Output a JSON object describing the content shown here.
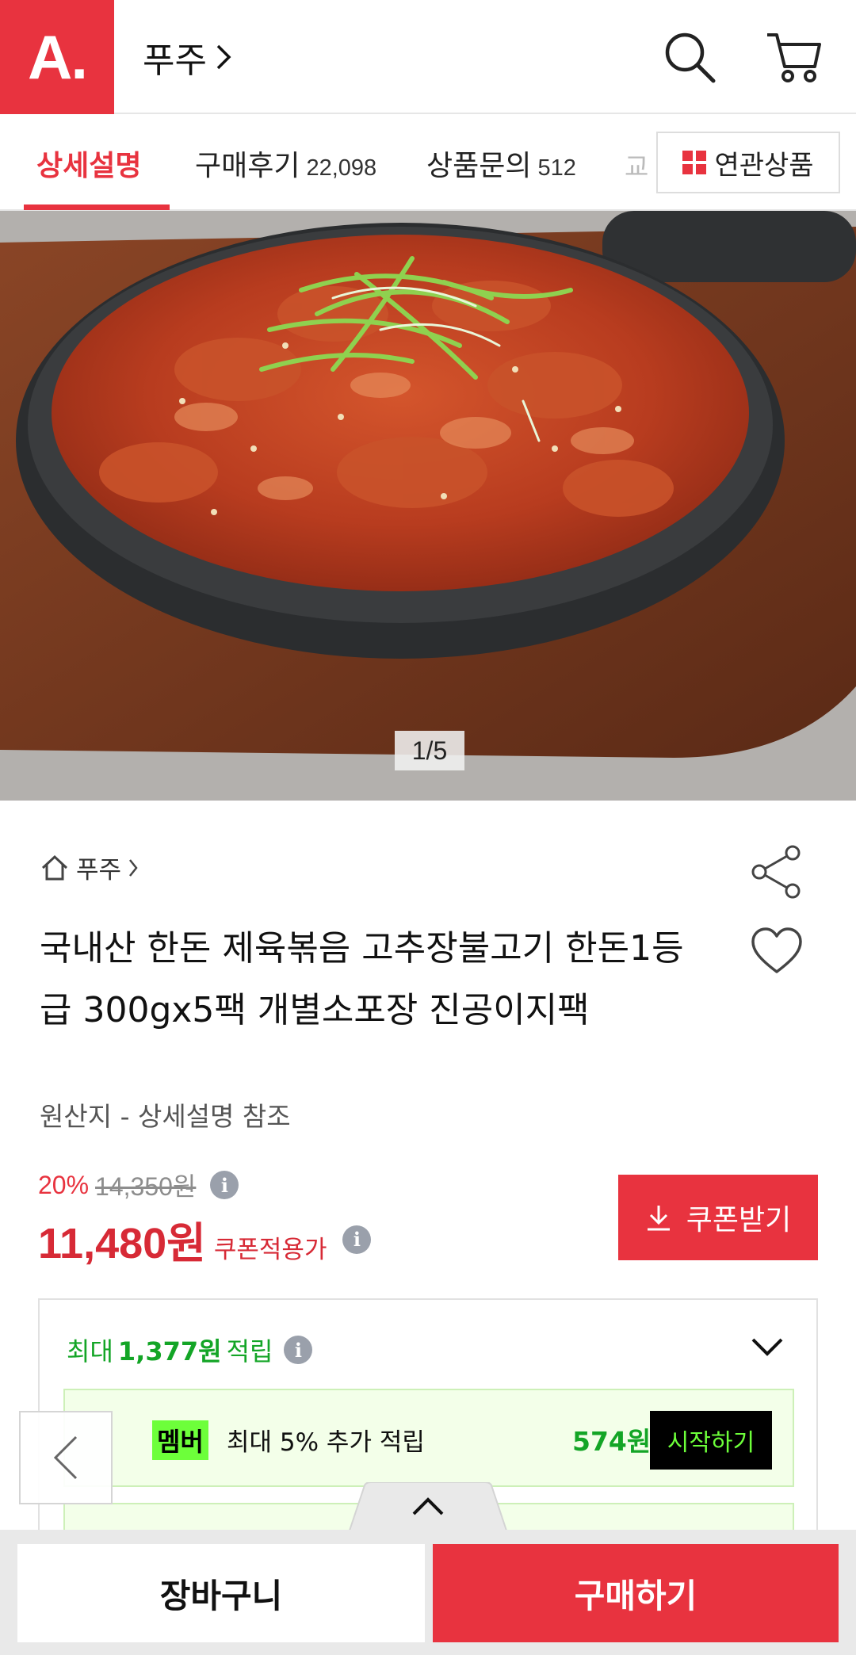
{
  "header": {
    "logo": "A.",
    "category": "푸주",
    "category_chevron": "›",
    "search_icon": "search-icon",
    "cart_icon": "cart-icon"
  },
  "tabs": {
    "detail": "상세설명",
    "reviews": "구매후기",
    "reviews_count": "22,098",
    "qna": "상품문의",
    "qna_count": "512",
    "partial": "교",
    "related": "연관상품"
  },
  "image": {
    "counter": "1/5"
  },
  "product": {
    "breadcrumb": "푸주",
    "title": "국내산 한돈 제육볶음 고추장불고기 한돈1등급 300gx5팩 개별소포장 진공이지팩",
    "origin": "원산지 - 상세설명 참조",
    "discount_rate": "20%",
    "original_price": "14,350원",
    "price": "11,480원",
    "price_label": "쿠폰적용가",
    "coupon_button": "쿠폰받기"
  },
  "points": {
    "prefix": "최대",
    "amount": "1,377원",
    "suffix": "적립",
    "member_badge": "멤버",
    "member_text": "최대 5% 추가 적립",
    "member_amount": "574원",
    "member_start": "시작하기"
  },
  "bottom": {
    "cart": "장바구니",
    "buy": "구매하기"
  },
  "colors": {
    "accent": "#e8333f",
    "points_green": "#13a526",
    "member_green": "#6dff3a"
  }
}
